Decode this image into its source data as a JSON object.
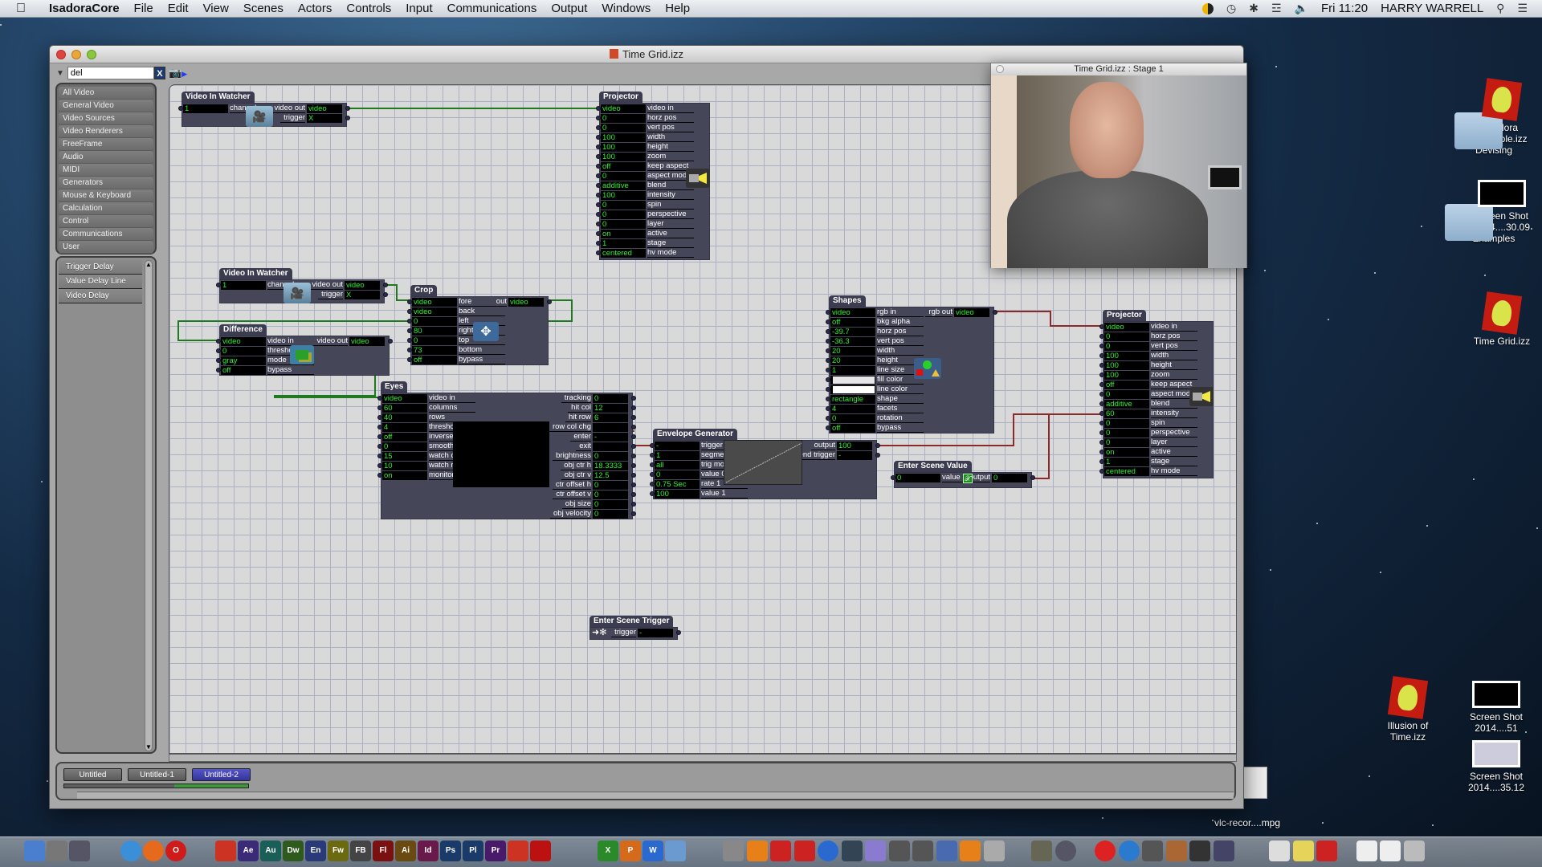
{
  "menubar": {
    "app_name": "IsadoraCore",
    "items": [
      "File",
      "Edit",
      "View",
      "Scenes",
      "Actors",
      "Controls",
      "Input",
      "Communications",
      "Output",
      "Windows",
      "Help"
    ],
    "clock": "Fri 11:20",
    "user": "HARRY WARRELL",
    "status_icons": [
      "symantec-icon",
      "time-machine-icon",
      "bluetooth-icon",
      "wifi-icon",
      "volume-icon"
    ]
  },
  "window": {
    "title": "Time Grid.izz",
    "search_value": "del",
    "search_clear": "X",
    "categories": [
      "All Video",
      "General Video",
      "Video Sources",
      "Video Renderers",
      "FreeFrame",
      "Audio",
      "MIDI",
      "Generators",
      "Mouse & Keyboard",
      "Calculation",
      "Control",
      "Communications",
      "User"
    ],
    "actor_results": [
      "Trigger Delay",
      "Value Delay Line",
      "Video Delay"
    ],
    "scenes": [
      {
        "label": "Untitled",
        "active": false
      },
      {
        "label": "Untitled-1",
        "active": false
      },
      {
        "label": "Untitled-2",
        "active": true
      }
    ],
    "scene_progress_fraction": 0.3
  },
  "actors": {
    "vin1": {
      "title": "Video In Watcher",
      "inputs": [
        {
          "value": "1",
          "label": "channel"
        }
      ],
      "outputs": [
        {
          "label": "video out",
          "value": "video"
        },
        {
          "label": "trigger",
          "value": "X"
        }
      ]
    },
    "vin2": {
      "title": "Video In Watcher",
      "inputs": [
        {
          "value": "1",
          "label": "channel"
        }
      ],
      "outputs": [
        {
          "label": "video out",
          "value": "video"
        },
        {
          "label": "trigger",
          "value": "X"
        }
      ]
    },
    "proj1": {
      "title": "Projector",
      "inputs": [
        {
          "value": "video",
          "label": "video in"
        },
        {
          "value": "0",
          "label": "horz pos"
        },
        {
          "value": "0",
          "label": "vert pos"
        },
        {
          "value": "100",
          "label": "width"
        },
        {
          "value": "100",
          "label": "height"
        },
        {
          "value": "100",
          "label": "zoom"
        },
        {
          "value": "off",
          "label": "keep aspect"
        },
        {
          "value": "0",
          "label": "aspect mod"
        },
        {
          "value": "additive",
          "label": "blend"
        },
        {
          "value": "100",
          "label": "intensity"
        },
        {
          "value": "0",
          "label": "spin"
        },
        {
          "value": "0",
          "label": "perspective"
        },
        {
          "value": "0",
          "label": "layer"
        },
        {
          "value": "on",
          "label": "active"
        },
        {
          "value": "1",
          "label": "stage"
        },
        {
          "value": "centered",
          "label": "hv mode"
        }
      ]
    },
    "crop": {
      "title": "Crop",
      "inputs": [
        {
          "value": "video",
          "label": "fore"
        },
        {
          "value": "video",
          "label": "back"
        },
        {
          "value": "0",
          "label": "left"
        },
        {
          "value": "80",
          "label": "right"
        },
        {
          "value": "0",
          "label": "top"
        },
        {
          "value": "73",
          "label": "bottom"
        },
        {
          "value": "off",
          "label": "bypass"
        }
      ],
      "outputs": [
        {
          "label": "out",
          "value": "video"
        }
      ]
    },
    "diff": {
      "title": "Difference",
      "inputs": [
        {
          "value": "video",
          "label": "video in"
        },
        {
          "value": "0",
          "label": "threshold"
        },
        {
          "value": "gray",
          "label": "mode"
        },
        {
          "value": "off",
          "label": "bypass"
        }
      ],
      "outputs": [
        {
          "label": "video out",
          "value": "video"
        }
      ]
    },
    "eyes": {
      "title": "Eyes",
      "inputs": [
        {
          "value": "video",
          "label": "video in"
        },
        {
          "value": "60",
          "label": "columns"
        },
        {
          "value": "40",
          "label": "rows"
        },
        {
          "value": "4",
          "label": "threshold"
        },
        {
          "value": "off",
          "label": "inverse"
        },
        {
          "value": "0",
          "label": "smoothing"
        },
        {
          "value": "15",
          "label": "watch col"
        },
        {
          "value": "10",
          "label": "watch row"
        },
        {
          "value": "on",
          "label": "monitor"
        }
      ],
      "outputs": [
        {
          "label": "tracking",
          "value": "0"
        },
        {
          "label": "hit col",
          "value": "12"
        },
        {
          "label": "hit row",
          "value": "6"
        },
        {
          "label": "row col chg",
          "value": ""
        },
        {
          "label": "enter",
          "value": "-"
        },
        {
          "label": "exit",
          "value": ""
        },
        {
          "label": "brightness",
          "value": "0"
        },
        {
          "label": "obj ctr h",
          "value": "18.3333"
        },
        {
          "label": "obj ctr v",
          "value": "12.5"
        },
        {
          "label": "ctr offset h",
          "value": "0"
        },
        {
          "label": "ctr offset v",
          "value": "0"
        },
        {
          "label": "obj size",
          "value": "0"
        },
        {
          "label": "obj velocity",
          "value": "0"
        }
      ]
    },
    "env": {
      "title": "Envelope Generator",
      "inputs": [
        {
          "value": "-",
          "label": "trigger"
        },
        {
          "value": "1",
          "label": "segments"
        },
        {
          "value": "all",
          "label": "trig mode"
        },
        {
          "value": "0",
          "label": "value 0"
        },
        {
          "value": "0.75 Sec",
          "label": "rate 1"
        },
        {
          "value": "100",
          "label": "value 1"
        }
      ],
      "outputs": [
        {
          "label": "output",
          "value": "100"
        },
        {
          "label": "end trigger",
          "value": "-"
        }
      ]
    },
    "shapes": {
      "title": "Shapes",
      "inputs": [
        {
          "value": "video",
          "label": "rgb in"
        },
        {
          "value": "off",
          "label": "bkg alpha"
        },
        {
          "value": "-39.7",
          "label": "horz pos"
        },
        {
          "value": "-36.3",
          "label": "vert pos"
        },
        {
          "value": "20",
          "label": "width"
        },
        {
          "value": "20",
          "label": "height"
        },
        {
          "value": "1",
          "label": "line size"
        },
        {
          "value": "",
          "label": "fill color"
        },
        {
          "value": "",
          "label": "line color"
        },
        {
          "value": "rectangle",
          "label": "shape"
        },
        {
          "value": "4",
          "label": "facets"
        },
        {
          "value": "0",
          "label": "rotation"
        },
        {
          "value": "off",
          "label": "bypass"
        }
      ],
      "outputs": [
        {
          "label": "rgb out",
          "value": "video"
        }
      ]
    },
    "esv": {
      "title": "Enter Scene Value",
      "inputs": [
        {
          "value": "0",
          "label": "value"
        }
      ],
      "outputs": [
        {
          "label": "output",
          "value": "0"
        }
      ]
    },
    "proj2": {
      "title": "Projector",
      "inputs": [
        {
          "value": "video",
          "label": "video in"
        },
        {
          "value": "0",
          "label": "horz pos"
        },
        {
          "value": "0",
          "label": "vert pos"
        },
        {
          "value": "100",
          "label": "width"
        },
        {
          "value": "100",
          "label": "height"
        },
        {
          "value": "100",
          "label": "zoom"
        },
        {
          "value": "off",
          "label": "keep aspect"
        },
        {
          "value": "0",
          "label": "aspect mod"
        },
        {
          "value": "additive",
          "label": "blend"
        },
        {
          "value": "60",
          "label": "intensity"
        },
        {
          "value": "0",
          "label": "spin"
        },
        {
          "value": "0",
          "label": "perspective"
        },
        {
          "value": "0",
          "label": "layer"
        },
        {
          "value": "on",
          "label": "active"
        },
        {
          "value": "1",
          "label": "stage"
        },
        {
          "value": "centered",
          "label": "hv mode"
        }
      ]
    },
    "est": {
      "title": "Enter Scene Trigger",
      "outputs": [
        {
          "label": "trigger",
          "value": "-"
        }
      ]
    }
  },
  "stage_window": {
    "title": "Time Grid.izz : Stage 1"
  },
  "desktop_icons": [
    {
      "label": "Isadora example.izz"
    },
    {
      "label": "Devising"
    },
    {
      "label": "Screen Shot 2014....30.09"
    },
    {
      "label": "Examples"
    },
    {
      "label": "Time Grid.izz"
    },
    {
      "label": "Illusion of Time.izz"
    },
    {
      "label": "Screen Shot 2014....51"
    },
    {
      "label": "Screen Shot 2014....35.12"
    },
    {
      "label": "vlc-recor....mpg"
    }
  ],
  "dock": {
    "left": [
      {
        "name": "finder",
        "text": "",
        "color": "#4a7fd0"
      },
      {
        "name": "launchpad",
        "text": "",
        "color": "#777"
      },
      {
        "name": "dashboard",
        "text": "",
        "color": "#556"
      },
      {
        "name": "safari",
        "text": "",
        "color": "#3a8fd8"
      },
      {
        "name": "firefox",
        "text": "",
        "color": "#e56a1c"
      },
      {
        "name": "opera",
        "text": "O",
        "color": "#d11a1a"
      },
      {
        "name": "acrobat",
        "text": "",
        "color": "#c32"
      },
      {
        "name": "after-effects",
        "text": "Ae",
        "color": "#3b2a78"
      },
      {
        "name": "audition",
        "text": "Au",
        "color": "#1a5e58"
      },
      {
        "name": "dreamweaver",
        "text": "Dw",
        "color": "#2f5a1e"
      },
      {
        "name": "encore",
        "text": "En",
        "color": "#2a3a78"
      },
      {
        "name": "fireworks",
        "text": "Fw",
        "color": "#6b6a10"
      },
      {
        "name": "flash-builder",
        "text": "FB",
        "color": "#444"
      },
      {
        "name": "flash",
        "text": "Fl",
        "color": "#7a1010"
      },
      {
        "name": "illustrator",
        "text": "Ai",
        "color": "#6a4a10"
      },
      {
        "name": "indesign",
        "text": "Id",
        "color": "#6a1a4a"
      },
      {
        "name": "photoshop",
        "text": "Ps",
        "color": "#1a3a6a"
      },
      {
        "name": "prelude",
        "text": "Pl",
        "color": "#1a3a6a"
      },
      {
        "name": "premiere",
        "text": "Pr",
        "color": "#4a1a6a"
      },
      {
        "name": "acrobat-reader",
        "text": "",
        "color": "#c32"
      },
      {
        "name": "isadora",
        "text": "",
        "color": "#b11"
      },
      {
        "name": "excel",
        "text": "X",
        "color": "#2a8a2a"
      },
      {
        "name": "powerpoint",
        "text": "P",
        "color": "#d46a1a"
      },
      {
        "name": "word",
        "text": "W",
        "color": "#2a6ad0"
      },
      {
        "name": "xcode",
        "text": "",
        "color": "#6a9ad0"
      }
    ],
    "right": [
      {
        "name": "cinema4d",
        "text": "",
        "color": "#888"
      },
      {
        "name": "blender",
        "text": "",
        "color": "#e8801a"
      },
      {
        "name": "sketchup",
        "text": "",
        "color": "#c22"
      },
      {
        "name": "flashcards",
        "text": "",
        "color": "#c22"
      },
      {
        "name": "quicktime",
        "text": "",
        "color": "#2a6ad0"
      },
      {
        "name": "imovie",
        "text": "",
        "color": "#345"
      },
      {
        "name": "iphoto",
        "text": "",
        "color": "#8a7ad0"
      },
      {
        "name": "final-cut",
        "text": "",
        "color": "#555"
      },
      {
        "name": "garageband",
        "text": "",
        "color": "#555"
      },
      {
        "name": "motion",
        "text": "",
        "color": "#4a6ab0"
      },
      {
        "name": "vlc",
        "text": "",
        "color": "#e8801a"
      },
      {
        "name": "ipod",
        "text": "",
        "color": "#aaa"
      },
      {
        "name": "preview",
        "text": "",
        "color": "#665"
      },
      {
        "name": "dvd-player",
        "text": "",
        "color": "#556"
      },
      {
        "name": "itunes",
        "text": "",
        "color": "#d22"
      },
      {
        "name": "app-store",
        "text": "",
        "color": "#2a7ad0"
      },
      {
        "name": "mail",
        "text": "",
        "color": "#555"
      },
      {
        "name": "guitar",
        "text": "",
        "color": "#a63"
      },
      {
        "name": "logic",
        "text": "",
        "color": "#333"
      },
      {
        "name": "compressor",
        "text": "",
        "color": "#446"
      },
      {
        "name": "pages",
        "text": "",
        "color": "#ddd"
      },
      {
        "name": "stickies",
        "text": "",
        "color": "#e6d35a"
      },
      {
        "name": "pdf-reader",
        "text": "",
        "color": "#c22"
      },
      {
        "name": "docx-1",
        "text": "",
        "color": "#eee"
      },
      {
        "name": "docx-2",
        "text": "",
        "color": "#eee"
      },
      {
        "name": "trash",
        "text": "",
        "color": "#bbb"
      }
    ]
  },
  "colors": {
    "value_green": "#2ef02e",
    "video_wire": "#1f7a1f",
    "value_wire": "#8b2a2a",
    "actor_body": "#464659",
    "active_scene": "#4444b0"
  }
}
